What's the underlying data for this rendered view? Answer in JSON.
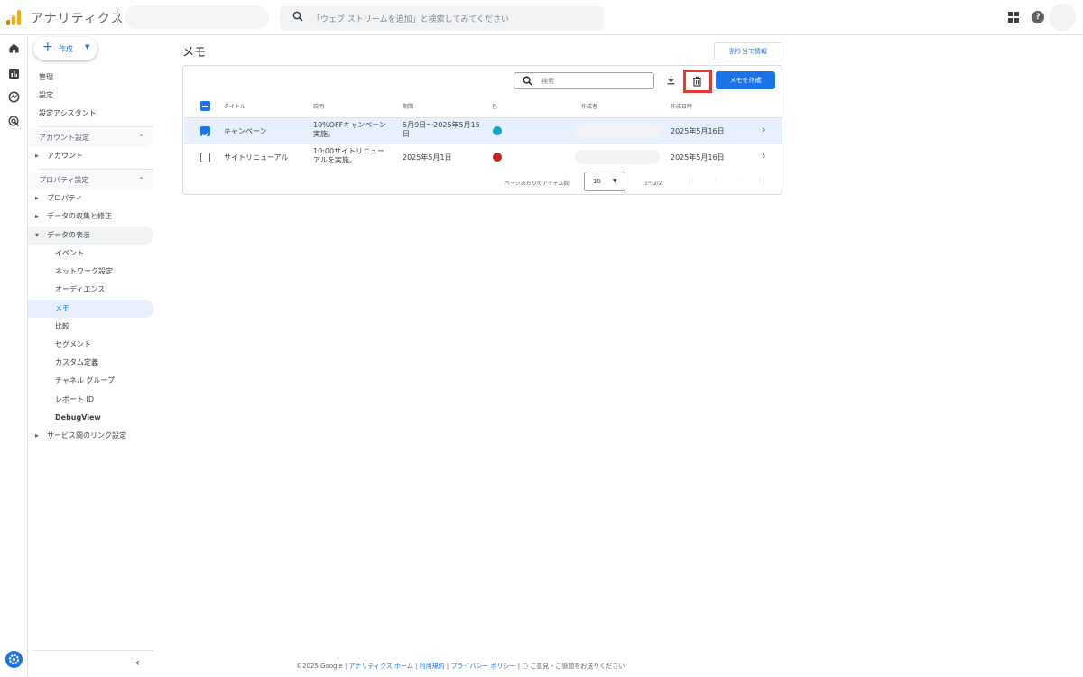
{
  "header": {
    "app_title": "アナリティクス",
    "search_placeholder": "「ウェブ ストリームを追加」と検索してみてください"
  },
  "nav": {
    "create_label": "作成",
    "items": [
      {
        "label": "管理"
      },
      {
        "label": "設定"
      },
      {
        "label": "設定アシスタント"
      },
      {
        "label": "アカウント設定"
      },
      {
        "label": "アカウント"
      },
      {
        "label": "プロパティ設定"
      },
      {
        "label": "プロパティ"
      },
      {
        "label": "データの収集と修正"
      },
      {
        "label": "データの表示"
      },
      {
        "label": "イベント"
      },
      {
        "label": "ネットワーク設定"
      },
      {
        "label": "オーディエンス"
      },
      {
        "label": "メモ"
      },
      {
        "label": "比較"
      },
      {
        "label": "セグメント"
      },
      {
        "label": "カスタム定義"
      },
      {
        "label": "チャネル グループ"
      },
      {
        "label": "レポート ID"
      },
      {
        "label": "DebugView"
      },
      {
        "label": "サービス間のリンク設定"
      }
    ]
  },
  "main": {
    "title": "メモ",
    "share_label": "割り当て情報",
    "search_placeholder": "検索",
    "create_memo_label": "メモを作成",
    "columns": [
      "タイトル",
      "説明",
      "期間",
      "色",
      "作成者",
      "作成日時"
    ],
    "rows": [
      {
        "title": "キャンペーン",
        "description_line1": "10%OFFキャンペーン",
        "description_line2": "実施。",
        "period_line1": "5月9日～2025年5月15",
        "period_line2": "日",
        "color": "#12a4c4",
        "created": "2025年5月16日",
        "selected": true
      },
      {
        "title": "サイトリニューアル",
        "description_line1": "10:00サイトリニュー",
        "description_line2": "アルを実施。",
        "period_line1": "2025年5月1日",
        "period_line2": "",
        "color": "#c5221f",
        "created": "2025年5月16日",
        "selected": false
      }
    ],
    "pager": {
      "items_per_page_label": "ページあたりのアイテム数:",
      "items_per_page": "10",
      "range": "1～2/2"
    }
  },
  "footer": {
    "copyright": "©2025 Google |",
    "link_home": "アナリティクス ホーム",
    "sep1": "|",
    "link_terms": "利用規約",
    "sep2": "|",
    "link_privacy": "プライバシー ポリシー",
    "sep3": "|",
    "feedback": "ご意見・ご感想をお送りください"
  },
  "colors": {
    "accent": "#1a73e8",
    "highlight": "#e53935"
  }
}
